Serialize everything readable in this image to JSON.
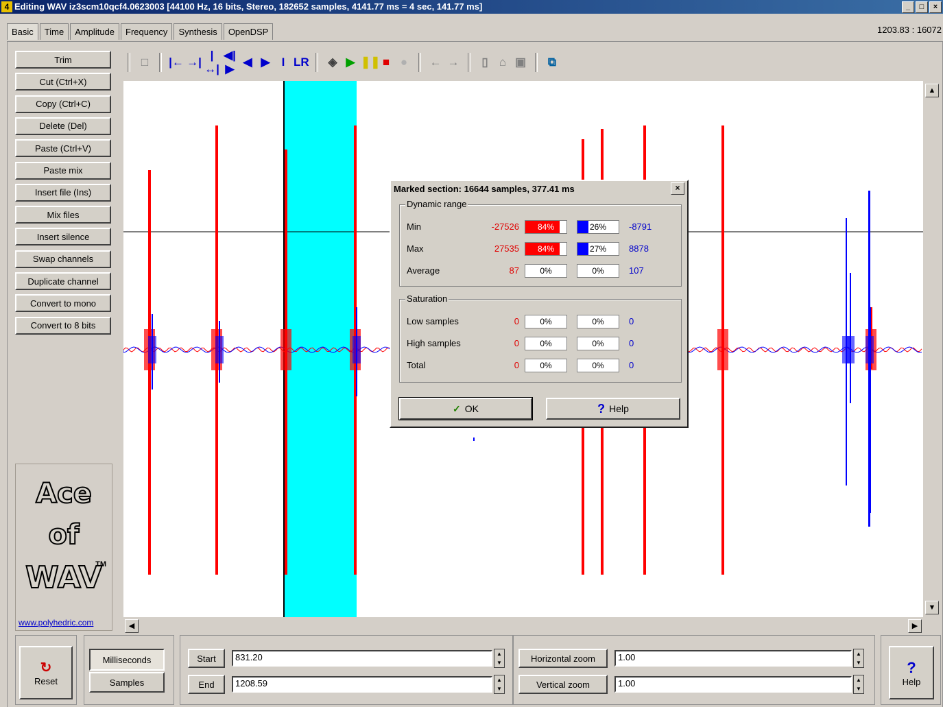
{
  "window": {
    "title": "Editing WAV iz3scm10qcf4.0623003 [44100 Hz, 16 bits, Stereo, 182652 samples, 4141.77 ms = 4 sec, 141.77 ms]",
    "app_icon": "4",
    "controls": [
      "_",
      "□",
      "×"
    ]
  },
  "tabs": [
    "Basic",
    "Time",
    "Amplitude",
    "Frequency",
    "Synthesis",
    "OpenDSP"
  ],
  "active_tab": "Basic",
  "coords": "1203.83 : 16072",
  "left_buttons": [
    "Trim",
    "Cut (Ctrl+X)",
    "Copy (Ctrl+C)",
    "Delete (Del)",
    "Paste (Ctrl+V)",
    "Paste mix",
    "Insert file (Ins)",
    "Mix files",
    "Insert silence",
    "Swap channels",
    "Duplicate channel",
    "Convert to mono",
    "Convert to 8 bits"
  ],
  "toolbar_icons": [
    "select-all-icon",
    "go-start-icon",
    "go-marker-start-icon",
    "go-marker-end-icon",
    "prev-marker-icon",
    "play-marked-icon",
    "step-back-icon",
    "step-forward-icon",
    "cursor-icon",
    "left-right-channel-icon",
    "speaker-icon",
    "play-icon",
    "pause-icon",
    "stop-icon",
    "record-icon",
    "undo-icon",
    "redo-icon",
    "new-file-icon",
    "open-file-icon",
    "save-file-icon",
    "save-as-icon"
  ],
  "logo": {
    "line1": "Ace",
    "line2": "of",
    "line3": "WAV",
    "tm": "TM",
    "link": "www.polyhedric.com"
  },
  "bottom": {
    "reset": "Reset",
    "milliseconds": "Milliseconds",
    "samples": "Samples",
    "start_label": "Start",
    "start_value": "831.20",
    "end_label": "End",
    "end_value": "1208.59",
    "hzoom_label": "Horizontal zoom",
    "hzoom_value": "1.00",
    "vzoom_label": "Vertical zoom",
    "vzoom_value": "1.00",
    "help": "Help"
  },
  "dialog": {
    "title": "Marked section: 16644 samples, 377.41 ms",
    "dynamic_range": "Dynamic range",
    "saturation": "Saturation",
    "rows": [
      {
        "label": "Min",
        "left": "-27526",
        "lp": "84%",
        "rp": "26%",
        "right": "-8791",
        "lfill": 0.84,
        "rfill": 0.26
      },
      {
        "label": "Max",
        "left": "27535",
        "lp": "84%",
        "rp": "27%",
        "right": "8878",
        "lfill": 0.84,
        "rfill": 0.27
      },
      {
        "label": "Average",
        "left": "87",
        "lp": "0%",
        "rp": "0%",
        "right": "107",
        "lfill": 0,
        "rfill": 0
      }
    ],
    "sat_rows": [
      {
        "label": "Low samples",
        "left": "0",
        "lp": "0%",
        "rp": "0%",
        "right": "0"
      },
      {
        "label": "High samples",
        "left": "0",
        "lp": "0%",
        "rp": "0%",
        "right": "0"
      },
      {
        "label": "Total",
        "left": "0",
        "lp": "0%",
        "rp": "0%",
        "right": "0"
      }
    ],
    "ok": "OK",
    "help": "Help"
  },
  "colors": {
    "left_channel": "#ff0000",
    "right_channel": "#0000ff",
    "selection": "#00ffff",
    "title_bar": "#0a246a"
  }
}
